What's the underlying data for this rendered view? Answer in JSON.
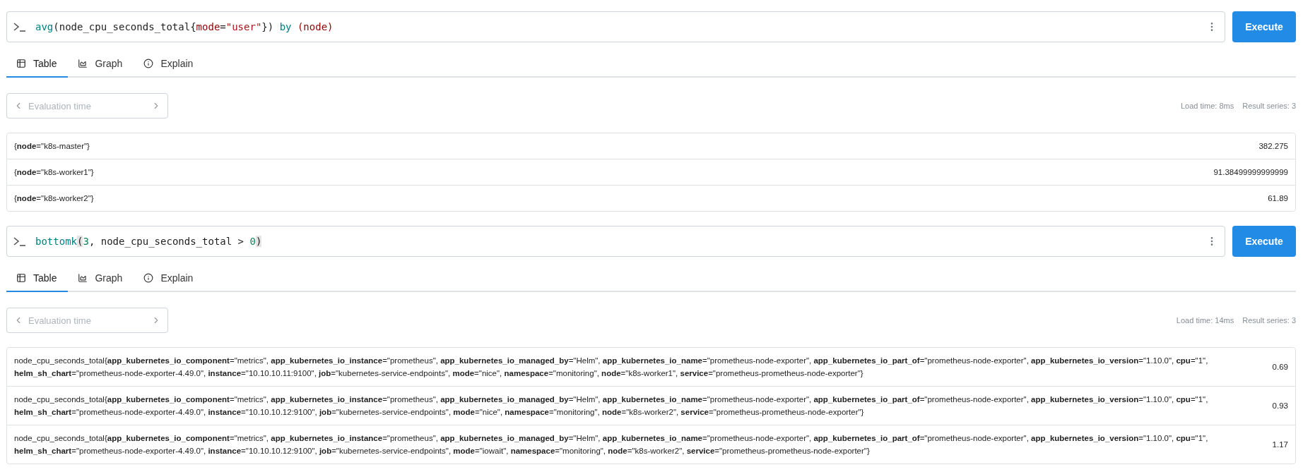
{
  "panels": [
    {
      "query": [
        {
          "text": "avg",
          "kind": "func"
        },
        {
          "text": "(node_cpu_seconds_total{",
          "kind": "plain"
        },
        {
          "text": "mode",
          "kind": "label"
        },
        {
          "text": "=",
          "kind": "plain"
        },
        {
          "text": "\"user\"",
          "kind": "string"
        },
        {
          "text": "}) ",
          "kind": "plain"
        },
        {
          "text": "by",
          "kind": "keyword"
        },
        {
          "text": " (node)",
          "kind": "label"
        }
      ],
      "execute": "Execute",
      "tabs": [
        {
          "label": "Table",
          "kind": "table",
          "selected": true
        },
        {
          "label": "Graph",
          "kind": "graph",
          "selected": false
        },
        {
          "label": "Explain",
          "kind": "explain",
          "selected": false
        }
      ],
      "eval_time": {
        "placeholder": "Evaluation time"
      },
      "load_time": "Load time: 8ms",
      "result_series": "Result series: 3",
      "rows": [
        {
          "series": "{**node**=\"k8s-master\"}",
          "value": "382.275"
        },
        {
          "series": "{**node**=\"k8s-worker1\"}",
          "value": "91.38499999999999"
        },
        {
          "series": "{**node**=\"k8s-worker2\"}",
          "value": "61.89"
        }
      ]
    },
    {
      "query": [
        {
          "text": "bottomk",
          "kind": "func"
        },
        {
          "text": "(",
          "kind": "bracket-match"
        },
        {
          "text": "3",
          "kind": "number"
        },
        {
          "text": ", node_cpu_seconds_total > ",
          "kind": "plain"
        },
        {
          "text": "0",
          "kind": "number"
        },
        {
          "text": ")",
          "kind": "bracket-match"
        }
      ],
      "execute": "Execute",
      "tabs": [
        {
          "label": "Table",
          "kind": "table",
          "selected": true
        },
        {
          "label": "Graph",
          "kind": "graph",
          "selected": false
        },
        {
          "label": "Explain",
          "kind": "explain",
          "selected": false
        }
      ],
      "eval_time": {
        "placeholder": "Evaluation time"
      },
      "load_time": "Load time: 14ms",
      "result_series": "Result series: 3",
      "rows": [
        {
          "series": "node_cpu_seconds_total{**app_kubernetes_io_component**=\"metrics\", **app_kubernetes_io_instance**=\"prometheus\", **app_kubernetes_io_managed_by**=\"Helm\", **app_kubernetes_io_name**=\"prometheus-node-exporter\", **app_kubernetes_io_part_of**=\"prometheus-node-exporter\", **app_kubernetes_io_version**=\"1.10.0\", **cpu**=\"1\", **helm_sh_chart**=\"prometheus-node-exporter-4.49.0\", **instance**=\"10.10.10.11:9100\", **job**=\"kubernetes-service-endpoints\", **mode**=\"nice\", **namespace**=\"monitoring\", **node**=\"k8s-worker1\", **service**=\"prometheus-prometheus-node-exporter\"}",
          "value": "0.69"
        },
        {
          "series": "node_cpu_seconds_total{**app_kubernetes_io_component**=\"metrics\", **app_kubernetes_io_instance**=\"prometheus\", **app_kubernetes_io_managed_by**=\"Helm\", **app_kubernetes_io_name**=\"prometheus-node-exporter\", **app_kubernetes_io_part_of**=\"prometheus-node-exporter\", **app_kubernetes_io_version**=\"1.10.0\", **cpu**=\"1\", **helm_sh_chart**=\"prometheus-node-exporter-4.49.0\", **instance**=\"10.10.10.12:9100\", **job**=\"kubernetes-service-endpoints\", **mode**=\"nice\", **namespace**=\"monitoring\", **node**=\"k8s-worker2\", **service**=\"prometheus-prometheus-node-exporter\"}",
          "value": "0.93"
        },
        {
          "series": "node_cpu_seconds_total{**app_kubernetes_io_component**=\"metrics\", **app_kubernetes_io_instance**=\"prometheus\", **app_kubernetes_io_managed_by**=\"Helm\", **app_kubernetes_io_name**=\"prometheus-node-exporter\", **app_kubernetes_io_part_of**=\"prometheus-node-exporter\", **app_kubernetes_io_version**=\"1.10.0\", **cpu**=\"1\", **helm_sh_chart**=\"prometheus-node-exporter-4.49.0\", **instance**=\"10.10.10.12:9100\", **job**=\"kubernetes-service-endpoints\", **mode**=\"iowait\", **namespace**=\"monitoring\", **node**=\"k8s-worker2\", **service**=\"prometheus-prometheus-node-exporter\"}",
          "value": "1.17"
        }
      ]
    }
  ]
}
